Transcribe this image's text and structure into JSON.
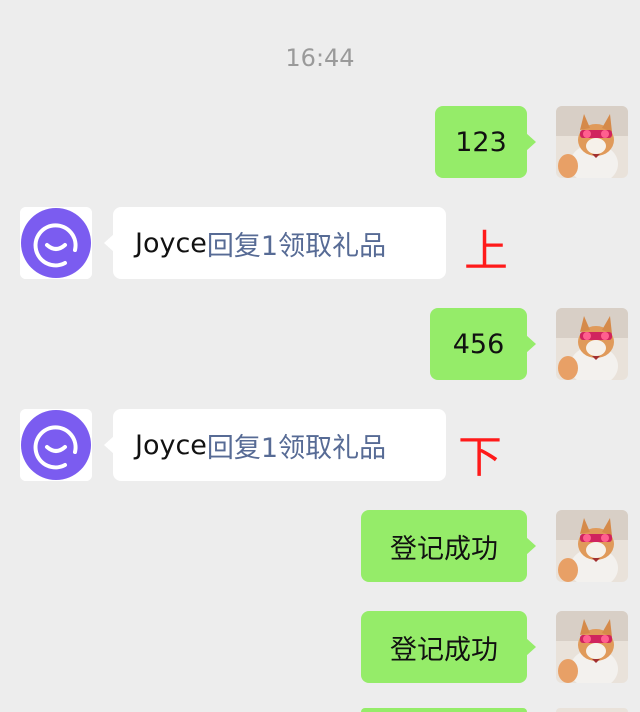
{
  "timestamp": "16:44",
  "messages": [
    {
      "side": "right",
      "text": "123"
    },
    {
      "side": "left",
      "name": "Joyce",
      "link": "回复1领取礼品",
      "annotation": "上"
    },
    {
      "side": "right",
      "text": "456"
    },
    {
      "side": "left",
      "name": "Joyce",
      "link": "回复1领取礼品",
      "annotation": "下"
    },
    {
      "side": "right",
      "text": "登记成功"
    },
    {
      "side": "right",
      "text": "登记成功"
    }
  ],
  "colors": {
    "background": "#ededed",
    "bubble_me": "#95ec69",
    "bubble_other": "#ffffff",
    "link": "#576b95",
    "annotation": "#ff1a1a",
    "bot_avatar": "#7b5cf0"
  },
  "icons": {
    "user_avatar": "cat-avatar-icon",
    "bot_avatar": "smiley-bot-avatar-icon"
  }
}
